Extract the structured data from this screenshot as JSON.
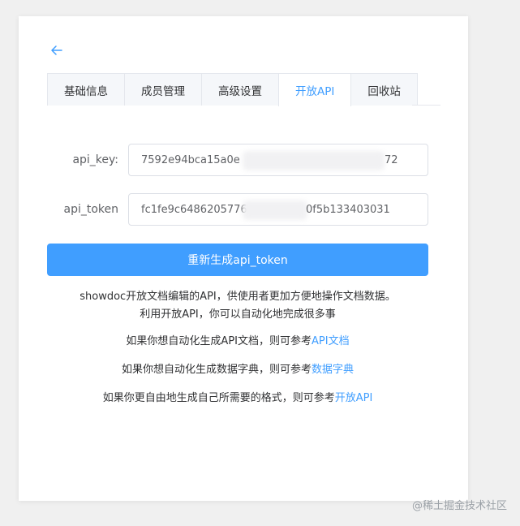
{
  "tabs": [
    {
      "label": "基础信息",
      "active": false
    },
    {
      "label": "成员管理",
      "active": false
    },
    {
      "label": "高级设置",
      "active": false
    },
    {
      "label": "开放API",
      "active": true
    },
    {
      "label": "回收站",
      "active": false
    }
  ],
  "form": {
    "api_key_label": "api_key:",
    "api_key_value_start": "7592e94bca15a0e",
    "api_key_value_end": "72",
    "api_token_label": "api_token",
    "api_token_value_start": "fc1fe9c6486205776",
    "api_token_value_end": "0f5b133403031"
  },
  "regen_button": "重新生成api_token",
  "description": {
    "line1": "showdoc开放文档编辑的API，供使用者更加方便地操作文档数据。",
    "line2": "利用开放API，你可以自动化地完成很多事",
    "p1_text": "如果你想自动化生成API文档，则可参考",
    "p1_link": "API文档",
    "p2_text": "如果你想自动化生成数据字典，则可参考",
    "p2_link": "数据字典",
    "p3_text": "如果你更自由地生成自己所需要的格式，则可参考",
    "p3_link": "开放API"
  },
  "watermark": "@稀土掘金技术社区",
  "colors": {
    "accent": "#409eff",
    "text": "#303133",
    "label": "#606266"
  },
  "icons": {
    "back": "arrow-left-icon"
  }
}
